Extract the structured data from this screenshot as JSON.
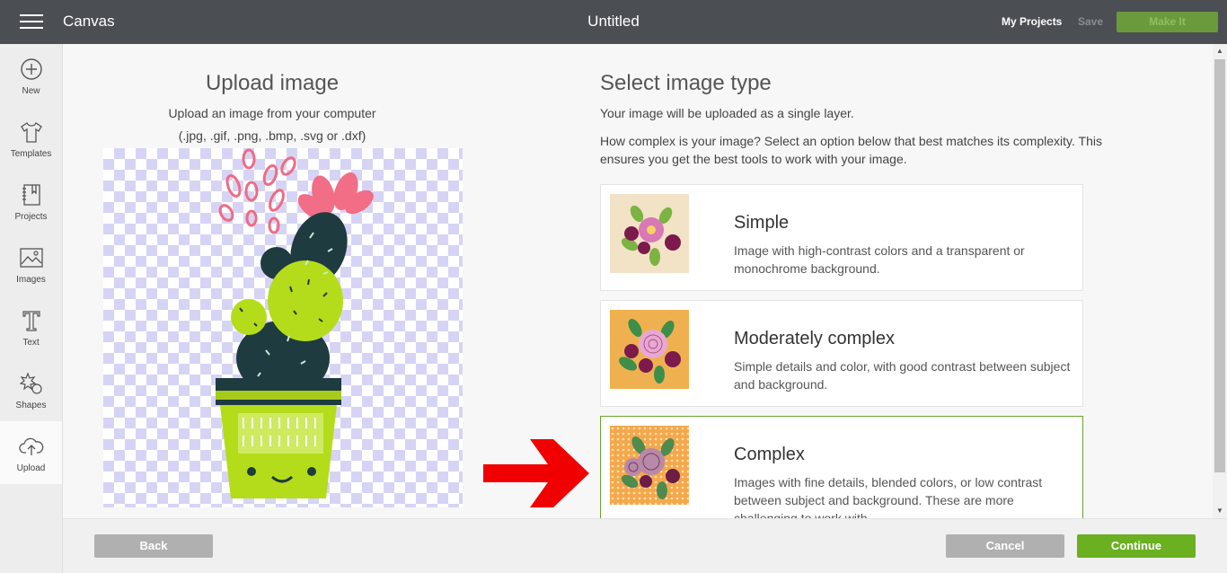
{
  "topbar": {
    "app_title": "Canvas",
    "doc_title": "Untitled",
    "my_projects": "My Projects",
    "save": "Save",
    "make_it": "Make It"
  },
  "sidebar": {
    "items": [
      {
        "label": "New",
        "icon": "plus-circle-icon"
      },
      {
        "label": "Templates",
        "icon": "tshirt-icon"
      },
      {
        "label": "Projects",
        "icon": "notebook-icon"
      },
      {
        "label": "Images",
        "icon": "image-icon"
      },
      {
        "label": "Text",
        "icon": "text-t-icon"
      },
      {
        "label": "Shapes",
        "icon": "shapes-icon"
      },
      {
        "label": "Upload",
        "icon": "cloud-upload-icon",
        "active": true
      }
    ]
  },
  "upload": {
    "title": "Upload image",
    "subtitle": "Upload an image from your computer",
    "formats": "(.jpg, .gif, .png, .bmp, .svg or .dxf)"
  },
  "select": {
    "title": "Select image type",
    "p1": "Your image will be uploaded as a single layer.",
    "p2": "How complex is your image? Select an option below that best matches its complexity. This ensures you get the best tools to work with your image.",
    "types": [
      {
        "name": "Simple",
        "desc": "Image with high-contrast colors and a transparent or monochrome background.",
        "thumb_bg": "#f2e3c6"
      },
      {
        "name": "Moderately complex",
        "desc": "Simple details and color, with good contrast between subject and background.",
        "thumb_bg": "#efb14f"
      },
      {
        "name": "Complex",
        "desc": "Images with fine details, blended colors, or low contrast between subject and background. These are more challenging to work with.",
        "thumb_bg": "#f5a84a",
        "selected": true
      }
    ]
  },
  "footer": {
    "back": "Back",
    "cancel": "Cancel",
    "continue": "Continue"
  },
  "colors": {
    "topbar": "#4b4f54",
    "accent_green": "#6ab021",
    "selected_border": "#6aa52f",
    "arrow": "#f00000"
  }
}
